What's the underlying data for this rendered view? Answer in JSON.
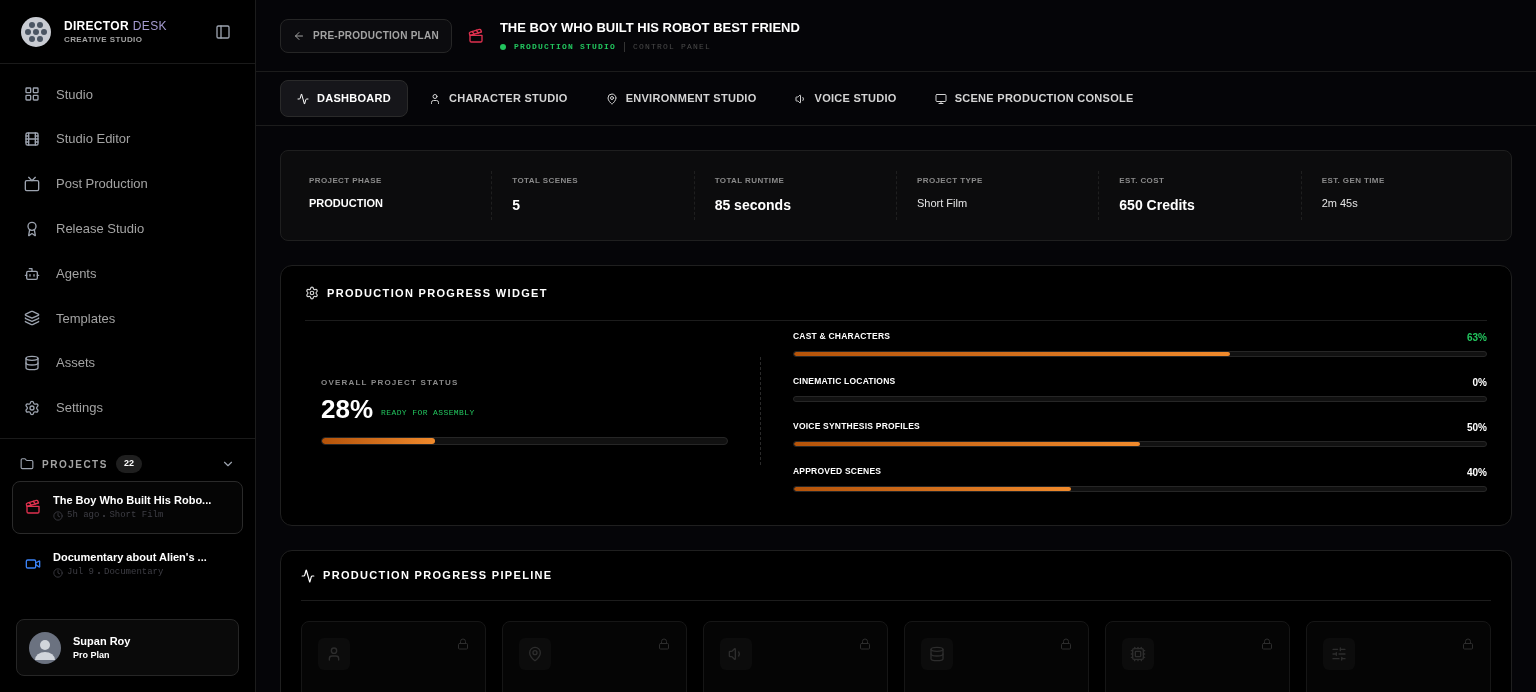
{
  "brand": {
    "name": "DIRECTOR",
    "accent": "DESK",
    "subtitle": "CREATIVE STUDIO"
  },
  "nav": [
    {
      "label": "Studio",
      "selected": false
    },
    {
      "label": "Studio Editor",
      "selected": false
    },
    {
      "label": "Post Production",
      "selected": false
    },
    {
      "label": "Release Studio",
      "selected": false
    },
    {
      "label": "Agents",
      "selected": false
    },
    {
      "label": "Templates",
      "selected": false
    },
    {
      "label": "Assets",
      "selected": false
    },
    {
      "label": "Settings",
      "selected": false
    }
  ],
  "projects": {
    "label": "PROJECTS",
    "count": "22",
    "expanded": true,
    "items": [
      {
        "title": "The Boy Who Built His Robo...",
        "time": "5h ago",
        "type": "Short Film",
        "kind": "clapper",
        "selected": true
      },
      {
        "title": "Documentary about Alien's ...",
        "time": "Jul 9",
        "type": "Documentary",
        "kind": "camera",
        "selected": false
      }
    ]
  },
  "user": {
    "name": "Supan Roy",
    "plan": "Pro Plan"
  },
  "header": {
    "back": "PRE-PRODUCTION PLAN",
    "title": "THE BOY WHO BUILT HIS ROBOT BEST FRIEND",
    "status": "PRODUCTION STUDIO",
    "context": "CONTROL PANEL"
  },
  "tabs": [
    {
      "label": "DASHBOARD",
      "selected": true
    },
    {
      "label": "CHARACTER STUDIO",
      "selected": false
    },
    {
      "label": "ENVIRONMENT STUDIO",
      "selected": false
    },
    {
      "label": "VOICE STUDIO",
      "selected": false
    },
    {
      "label": "SCENE PRODUCTION CONSOLE",
      "selected": false
    }
  ],
  "stats": [
    {
      "label": "PROJECT PHASE",
      "value": "PRODUCTION",
      "kind": "strong"
    },
    {
      "label": "TOTAL SCENES",
      "value": "5",
      "kind": "large"
    },
    {
      "label": "TOTAL RUNTIME",
      "value": "85 seconds",
      "kind": "large"
    },
    {
      "label": "PROJECT TYPE",
      "value": "Short Film",
      "kind": "plain"
    },
    {
      "label": "EST. COST",
      "value": "650 Credits",
      "kind": "large"
    },
    {
      "label": "EST. GEN TIME",
      "value": "2m 45s",
      "kind": "plain"
    }
  ],
  "widget": {
    "title": "PRODUCTION PROGRESS WIDGET",
    "overall": {
      "label": "OVERALL PROJECT STATUS",
      "value": "28%",
      "status": "READY FOR ASSEMBLY",
      "level": 0.28
    },
    "items": [
      {
        "label": "CAST & CHARACTERS",
        "reading": "63%",
        "level": 0.63,
        "color": "#22c55e"
      },
      {
        "label": "CINEMATIC LOCATIONS",
        "reading": "0%",
        "level": 0,
        "color": "#ffffff"
      },
      {
        "label": "VOICE SYNTHESIS PROFILES",
        "reading": "50%",
        "level": 0.5,
        "color": "#ffffff"
      },
      {
        "label": "APPROVED SCENES",
        "reading": "40%",
        "level": 0.4,
        "color": "#ffffff"
      }
    ]
  },
  "pipeline": {
    "title": "PRODUCTION PROGRESS PIPELINE",
    "stages": [
      {
        "locked": true
      },
      {
        "locked": true
      },
      {
        "locked": true
      },
      {
        "locked": true
      },
      {
        "locked": true
      },
      {
        "locked": true
      }
    ]
  }
}
